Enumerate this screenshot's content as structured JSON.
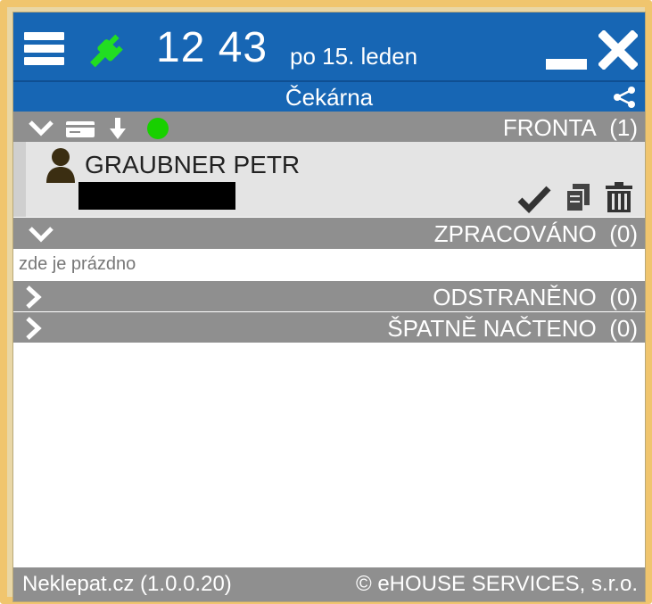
{
  "header": {
    "time": "12 43",
    "date": "po 15. leden",
    "menu_icon": "hamburger-menu-icon",
    "connection_icon": "plug-icon",
    "connection_color": "#22dd22"
  },
  "subheader": {
    "title": "Čekárna",
    "share_icon": "share-icon"
  },
  "sections": {
    "queue": {
      "label": "FRONTA",
      "count": "(1)"
    },
    "processed": {
      "label": "ZPRACOVÁNO",
      "count": "(0)",
      "empty_text": "zde je prázdno"
    },
    "removed": {
      "label": "ODSTRANĚNO",
      "count": "(0)"
    },
    "misread": {
      "label": "ŠPATNĚ NAČTENO",
      "count": "(0)"
    }
  },
  "queue_items": [
    {
      "name": "GRAUBNER PETR"
    }
  ],
  "footer": {
    "left": "Neklepat.cz (1.0.0.20)",
    "right": "© eHOUSE SERVICES, s.r.o."
  },
  "colors": {
    "header_blue": "#1766b4",
    "section_gray": "#8f8f8f",
    "status_green": "#18d000",
    "frame_gold": "#f0c56e"
  }
}
